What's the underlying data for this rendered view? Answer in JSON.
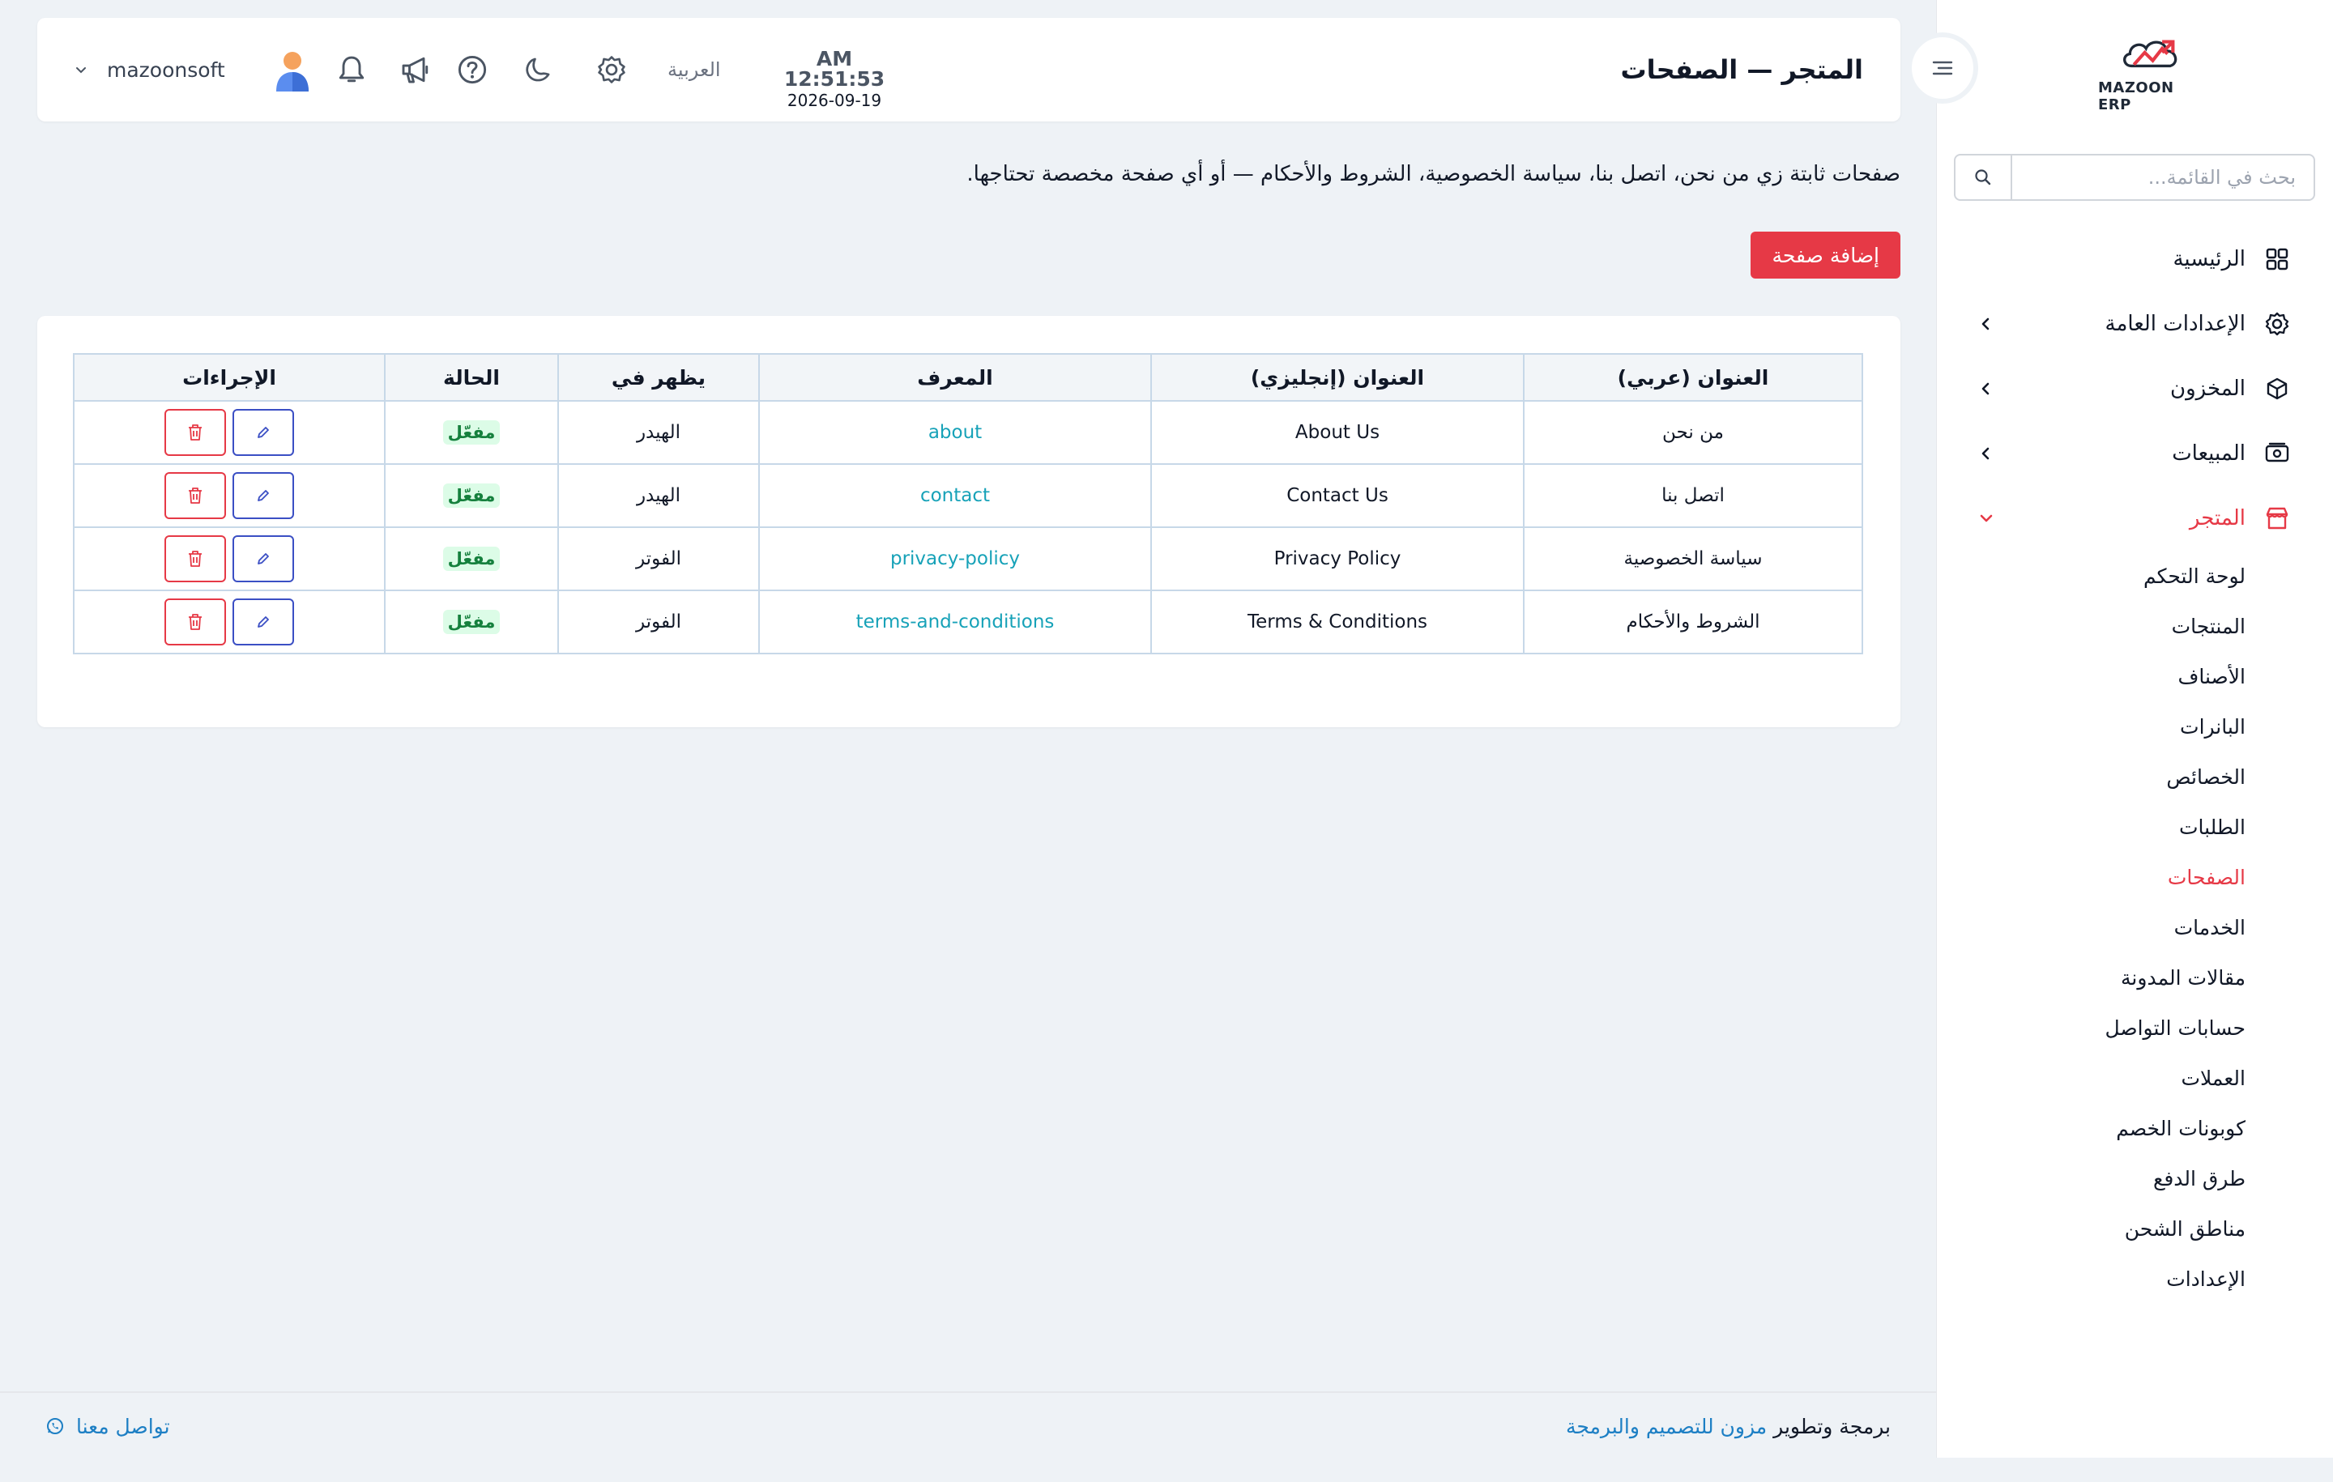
{
  "brand": {
    "logo_text": "MAZOON ERP",
    "logo_small": "ERP",
    "accent": "#e63946"
  },
  "sidebar": {
    "search_placeholder": "بحث في القائمة...",
    "items": [
      {
        "label": "الرئيسية",
        "icon": "grid-icon"
      },
      {
        "label": "الإعدادات العامة",
        "icon": "gear-icon"
      },
      {
        "label": "المخزون",
        "icon": "box-icon"
      },
      {
        "label": "المبيعات",
        "icon": "cash-icon"
      },
      {
        "label": "المتجر",
        "icon": "store-icon"
      }
    ],
    "store_sub": [
      "لوحة التحكم",
      "المنتجات",
      "الأصناف",
      "البانرات",
      "الخصائص",
      "الطلبات",
      "الصفحات",
      "الخدمات",
      "مقالات المدونة",
      "حسابات التواصل",
      "العملات",
      "كوبونات الخصم",
      "طرق الدفع",
      "مناطق الشحن",
      "الإعدادات"
    ],
    "active_sub": "الصفحات"
  },
  "header": {
    "title": "المتجر — الصفحات",
    "time": "AM 12:51:53",
    "date": "2026-09-19",
    "language": "العربية",
    "username": "mazoonsoft"
  },
  "intro": {
    "text": "صفحات ثابتة زي من نحن، اتصل بنا، سياسة الخصوصية، الشروط والأحكام — أو أي صفحة مخصصة تحتاجها.",
    "add_button": "إضافة صفحة"
  },
  "table": {
    "headers": [
      "العنوان (عربي)",
      "العنوان (إنجليزي)",
      "المعرف",
      "يظهر في",
      "الحالة",
      "الإجراءات"
    ],
    "rows": [
      {
        "title_ar": "من نحن",
        "title_en": "About Us",
        "slug": "about",
        "location": "الهيدر",
        "status": "مفعّل"
      },
      {
        "title_ar": "اتصل بنا",
        "title_en": "Contact Us",
        "slug": "contact",
        "location": "الهيدر",
        "status": "مفعّل"
      },
      {
        "title_ar": "سياسة الخصوصية",
        "title_en": "Privacy Policy",
        "slug": "privacy-policy",
        "location": "الفوتر",
        "status": "مفعّل"
      },
      {
        "title_ar": "الشروط والأحكام",
        "title_en": "Terms & Conditions",
        "slug": "terms-and-conditions",
        "location": "الفوتر",
        "status": "مفعّل"
      }
    ]
  },
  "footer": {
    "credit_prefix": "برمجة وتطوير",
    "credit_link": "مزون للتصميم والبرمجة",
    "contact": "تواصل معنا"
  }
}
